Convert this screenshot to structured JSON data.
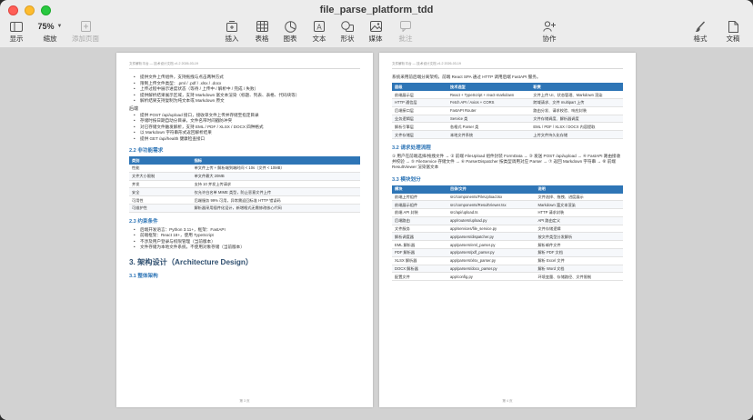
{
  "window": {
    "title": "file_parse_platform_tdd"
  },
  "toolbar": {
    "display_label": "显示",
    "zoom_value": "75%",
    "zoom_label": "缩放",
    "add_page_label": "添加页面",
    "insert_label": "插入",
    "table_label": "表格",
    "chart_label": "图表",
    "text_label": "文本",
    "shape_label": "形状",
    "media_label": "媒体",
    "comment_label": "批注",
    "collaborate_label": "协作",
    "format_label": "格式",
    "document_label": "文稿"
  },
  "left_page": {
    "header": "文件解析平台 — 技术设计文档   v1.2   2026-03-19",
    "bullets_top": [
      "提供文件上传组件，支持拖拽与点击两种方式",
      "限制上传文件类型：.pml / .pdf / .xlsx / .docx",
      "上传过程中展示进度状态（等待 / 上传中 / 解析中 / 完成 / 失败）",
      "提供解析结果展示区域，支持 Markdown 富文本渲染（标题、列表、表格、代码块等）",
      "解析结果支持复制为纯文本或 Markdown 原文"
    ],
    "backend_label": "后端",
    "bullets_backend": [
      "提供 POST /api/upload 接口，接收单文件上传并存储至指定目录",
      "存储时按日期自动分目录，文件名带时间戳防冲突",
      "对已存储文件触发解析，支持 EML / PDF / XLSX / DOCX 四种格式",
      "以 Markdown 字符串形式返回解析结果",
      "提供 GET /api/health 健康检查接口"
    ],
    "sec_nonfunc": "2.2 非功能需求",
    "nonfunc_table": {
      "headers": [
        "类别",
        "指标"
      ],
      "rows": [
        [
          "性能",
          "单文件上传 + 解析端到端时间 < 10s（文件 < 10MB）"
        ],
        [
          "文件大小限制",
          "单文件最大 20MB"
        ],
        [
          "并发",
          "支持 10 并发上传请求"
        ],
        [
          "安全",
          "仅允许白名单 MIME 类型，防止恶意文件上传"
        ],
        [
          "可用性",
          "后端服务 99% 可用，异常需返回标准 HTTP 错误码"
        ],
        [
          "可维护性",
          "解析器采用插件化设计，新增格式无需修改核心代码"
        ]
      ]
    },
    "sec_constraints": "2.3 约束条件",
    "bullets_constraints": [
      "后端开发语言：Python 3.11+，框架：FastAPI",
      "前端框架：React 18+，使用 TypeScript",
      "不涉及用户登录与权限管理（当前版本）",
      "文件存储为本地文件系统，不使用对象存储（当前版本）"
    ],
    "sec_arch": "3. 架构设计（Architecture Design）",
    "sec_overall": "3.1 整体架构",
    "footer": "第 3 页"
  },
  "right_page": {
    "header": "文件解析平台 — 技术设计文档   v1.2   2026-03-19",
    "intro": "系统采用前后端分离架构，前端 React SPA 通过 HTTP 调用后端 FastAPI 服务。",
    "arch_table": {
      "headers": [
        "层级",
        "技术选型",
        "职责"
      ],
      "rows": [
        [
          "前端展示层",
          "React + TypeScript + react-markdown",
          "文件上传 UI、状态管理、Markdown 渲染"
        ],
        [
          "HTTP 通信层",
          "Fetch API / Axios + CORS",
          "跨域请求、文件 multipart 上传"
        ],
        [
          "后端接口层",
          "FastAPI Router",
          "路由分发、请求校验、响应封装"
        ],
        [
          "业务逻辑层",
          "Service 类",
          "文件存储调度、解析器调度"
        ],
        [
          "解析引擎层",
          "各格式 Parser 类",
          "EML / PDF / XLSX / DOCX 内容提取"
        ],
        [
          "文件存储层",
          "本地文件系统",
          "上传文件持久化存储"
        ]
      ]
    },
    "sec_flow": "3.2 请求处理流程",
    "flow_text": "① 用户在前端选择/拖拽文件 → ② 前端 FileUpload 组件封装 FormData → ③ 发送 POST /api/upload → ④ FastAPI 路由接收并校验 → ⑤ FileService 存储文件 → ⑥ ParserDispatcher 按类型调用对应 Parser → ⑦ 返回 Markdown 字符串 → ⑧ 前端 ResultViewer 渲染富文本",
    "sec_modules": "3.3 模块划分",
    "modules_table": {
      "headers": [
        "模块",
        "目录/文件",
        "说明"
      ],
      "rows": [
        [
          "前端上传组件",
          "src/components/FileUpload.tsx",
          "文件选择、拖拽、进度展示"
        ],
        [
          "前端展示组件",
          "src/components/ResultViewer.tsx",
          "Markdown 富文本渲染"
        ],
        [
          "前端 API 封装",
          "src/api/upload.ts",
          "HTTP 请求封装"
        ],
        [
          "后端路由",
          "app/routers/upload.py",
          "API 路由定义"
        ],
        [
          "文件服务",
          "app/services/file_service.py",
          "文件存储逻辑"
        ],
        [
          "解析调度器",
          "app/parsers/dispatcher.py",
          "按文件类型分发解析"
        ],
        [
          "EML 解析器",
          "app/parsers/eml_parser.py",
          "解析邮件文件"
        ],
        [
          "PDF 解析器",
          "app/parsers/pdf_parser.py",
          "解析 PDF 文档"
        ],
        [
          "XLSX 解析器",
          "app/parsers/xlsx_parser.py",
          "解析 Excel 文件"
        ],
        [
          "DOCX 解析器",
          "app/parsers/docx_parser.py",
          "解析 Word 文档"
        ],
        [
          "配置文件",
          "app/config.py",
          "环境变量、存储路径、文件限制"
        ]
      ]
    },
    "footer": "第 4 页"
  }
}
